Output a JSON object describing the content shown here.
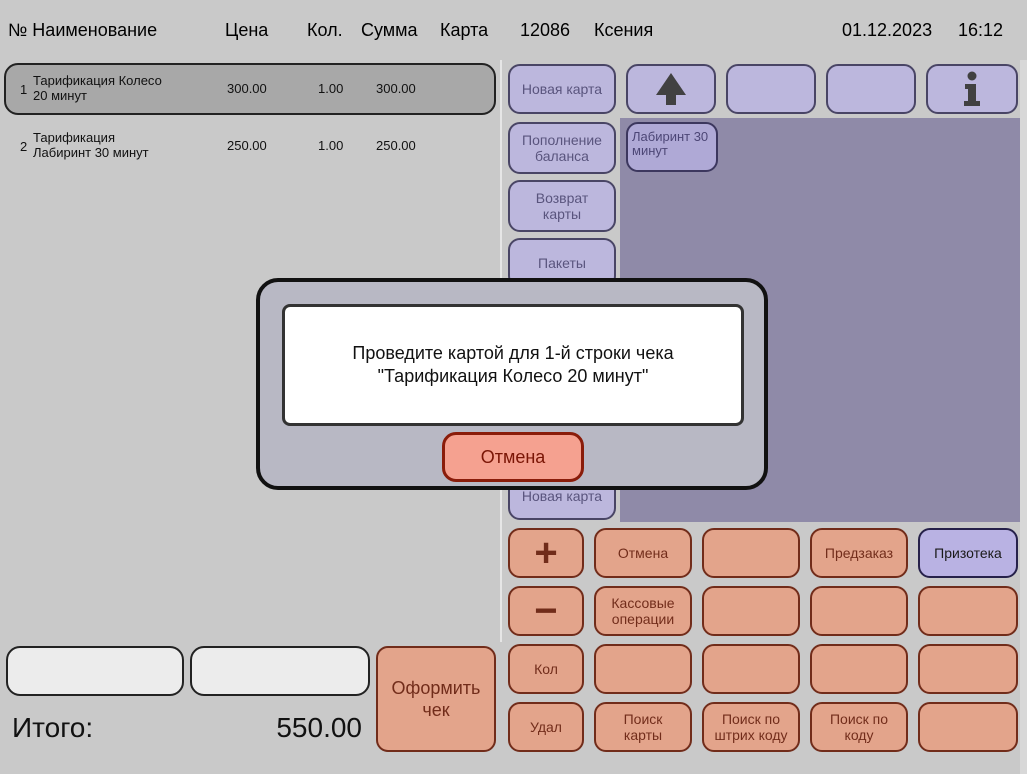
{
  "header": {
    "col_name": "№ Наименование",
    "col_price": "Цена",
    "col_qty": "Кол.",
    "col_sum": "Сумма",
    "col_card": "Карта",
    "terminal_id": "12086",
    "cashier": "Ксения",
    "date": "01.12.2023",
    "time": "16:12"
  },
  "receipt": {
    "rows": [
      {
        "num": "1",
        "name_l1": "Тарификация Колесо",
        "name_l2": "20 минут",
        "price": "300.00",
        "qty": "1.00",
        "sum": "300.00"
      },
      {
        "num": "2",
        "name_l1": "Тарификация",
        "name_l2": "Лабиринт 30 минут",
        "price": "250.00",
        "qty": "1.00",
        "sum": "250.00"
      }
    ]
  },
  "side_buttons": {
    "new_card": "Новая карта",
    "topup_l1": "Пополнение",
    "topup_l2": "баланса",
    "return_l1": "Возврат",
    "return_l2": "карты",
    "packages": "Пакеты",
    "new_card_2": "Новая карта"
  },
  "product_tile": {
    "l1": "Лабиринт 30",
    "l2": "минут"
  },
  "keypad": {
    "plus": "+",
    "minus": "−",
    "qty": "Кол",
    "delete": "Удал",
    "cancel": "Отмена",
    "cash_ops_l1": "Кассовые",
    "cash_ops_l2": "операции",
    "search_card_l1": "Поиск",
    "search_card_l2": "карты",
    "search_barcode_l1": "Поиск по",
    "search_barcode_l2": "штрих коду",
    "search_code_l1": "Поиск по",
    "search_code_l2": "коду",
    "preorder": "Предзаказ",
    "prize_store": "Призотека"
  },
  "footer": {
    "total_label": "Итого:",
    "total_value": "550.00",
    "checkout_l1": "Оформить",
    "checkout_l2": "чек"
  },
  "dialog": {
    "message_l1": "Проведите картой для 1-й строки чека",
    "message_l2": "\"Тарификация Колесо 20 минут\"",
    "cancel_label": "Отмена"
  },
  "colors": {
    "purple": "#b9b2e3",
    "peach": "#e6a186",
    "panel_purple": "#8f8aa8",
    "dialog_frame": "#b8b8c4",
    "dialog_cancel": "#f5a190"
  }
}
